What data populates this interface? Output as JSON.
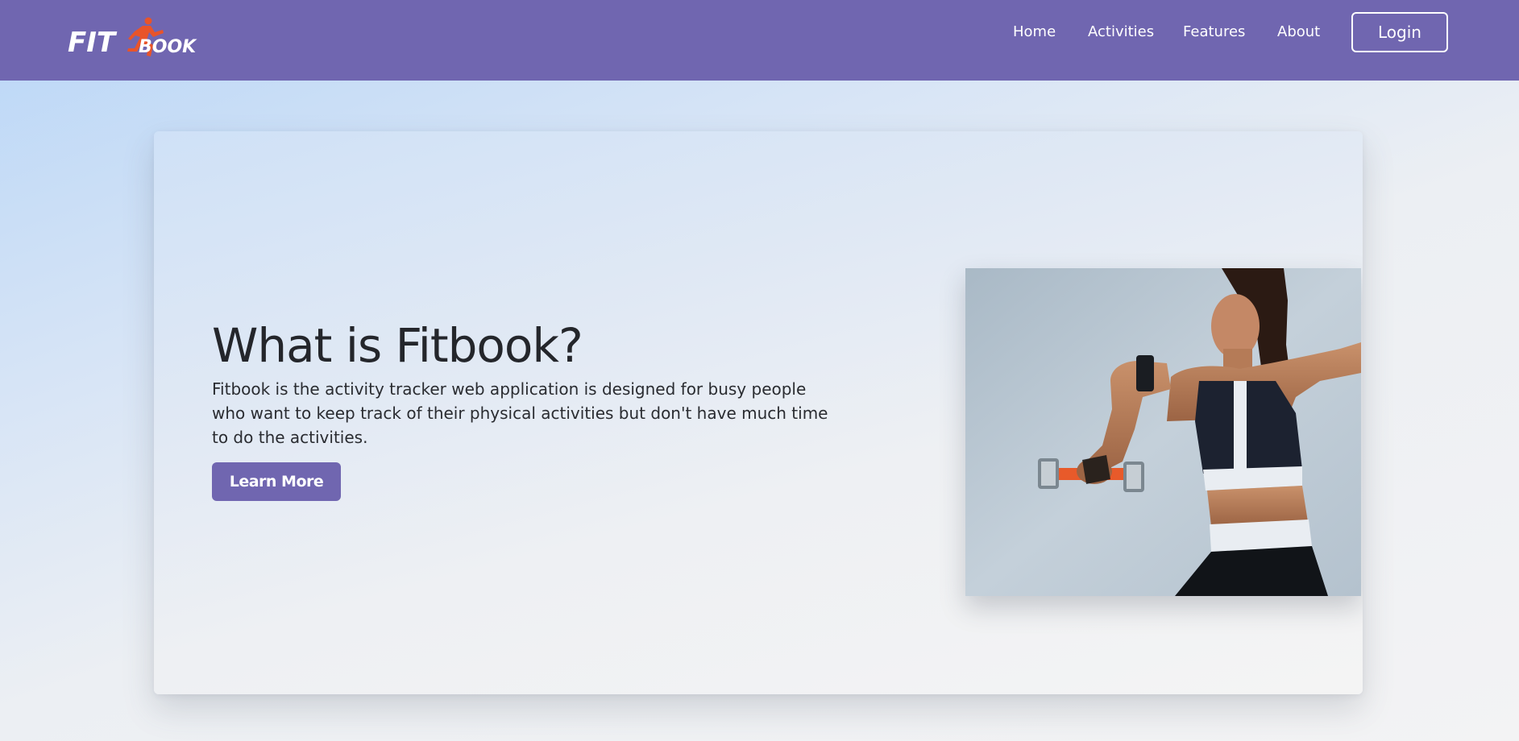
{
  "brand": {
    "logo_text_fit": "FIT",
    "logo_text_book": "BOOK",
    "accent_color": "#7066b0",
    "logo_accent_color": "#e8542a"
  },
  "nav": {
    "items": [
      {
        "label": "Home"
      },
      {
        "label": "Activities"
      },
      {
        "label": "Features"
      },
      {
        "label": "About"
      }
    ],
    "login_label": "Login"
  },
  "hero": {
    "title": "What is Fitbook?",
    "description": "Fitbook is the activity tracker web application is designed for busy people who want to keep track of their physical activities but don't have much time to do the activities.",
    "button_label": "Learn More",
    "image_icon": "woman-with-dumbbell-photo"
  }
}
